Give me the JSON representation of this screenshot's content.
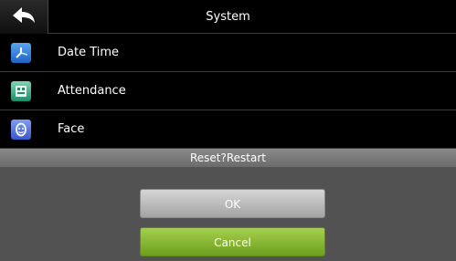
{
  "header": {
    "title": "System",
    "back_icon": "back-arrow-icon"
  },
  "menu": {
    "items": [
      {
        "label": "Date Time",
        "icon": "date-time-icon"
      },
      {
        "label": "Attendance",
        "icon": "attendance-icon"
      },
      {
        "label": "Face",
        "icon": "face-icon"
      }
    ]
  },
  "dialog": {
    "title": "Reset?Restart",
    "ok_label": "OK",
    "cancel_label": "Cancel"
  },
  "colors": {
    "ok_button": "#a3a3a3",
    "cancel_button": "#6d9f1e",
    "dialog_background": "#525252"
  }
}
